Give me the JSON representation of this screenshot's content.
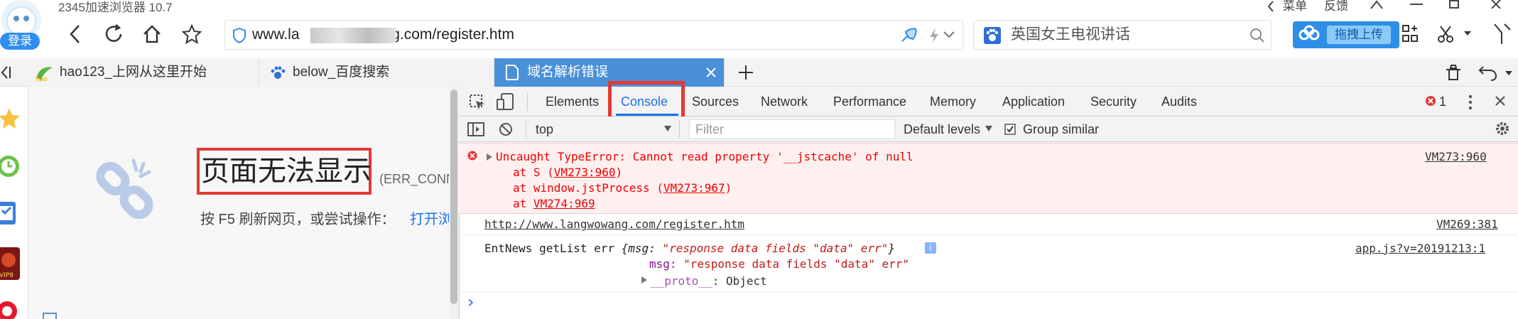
{
  "app": {
    "title": "2345加速浏览器 10.7",
    "login_label": "登录",
    "menu_label": "菜单",
    "feedback_label": "反馈"
  },
  "nav": {
    "url_prefix": "www.la",
    "url_suffix": "ng.com/register.htm",
    "search_text": "英国女王电视讲话",
    "upload_label": "拖拽上传"
  },
  "tabs": [
    {
      "label": "hao123_上网从这里开始",
      "icon": "hao123-icon"
    },
    {
      "label": "below_百度搜索",
      "icon": "baidu-paw-icon"
    },
    {
      "label": "域名解析错误",
      "icon": "page-icon",
      "active": true
    }
  ],
  "page": {
    "title": "页面无法显示",
    "code": "(ERR_CONN",
    "hint": "按 F5 刷新网页，或尝试操作：",
    "link": "打开浏"
  },
  "devtools": {
    "tabs": [
      "Elements",
      "Console",
      "Sources",
      "Network",
      "Performance",
      "Memory",
      "Application",
      "Security",
      "Audits"
    ],
    "active_tab": "Console",
    "error_count": "1",
    "context": "top",
    "filter_placeholder": "Filter",
    "levels": "Default levels",
    "group_similar": "Group similar",
    "messages": {
      "error": {
        "line1": "Uncaught TypeError: Cannot read property '__jstcache' of null",
        "line2_pre": "at S (",
        "line2_link": "VM273:960",
        "line2_post": ")",
        "line3_pre": "at window.jstProcess (",
        "line3_link": "VM273:967",
        "line3_post": ")",
        "line4_pre": "at ",
        "line4_link": "VM274:969",
        "source": "VM273:960"
      },
      "log1": {
        "text": "http://www.langwowang.com/register.htm",
        "source": "VM269:381"
      },
      "log2": {
        "prefix": "EntNews getList err ",
        "obj_open": "{msg: ",
        "obj_str": "\"response data fields \"data\" err\"",
        "obj_close": "}",
        "info_badge": "i",
        "msg_key": "msg:",
        "msg_val": "\"response data fields \"data\" err\"",
        "proto_key": "__proto__",
        "proto_val": ": Object",
        "source": "app.js?v=20191213:1"
      },
      "prompt": "›"
    }
  },
  "colors": {
    "accent": "#1a73e8",
    "active_tab": "#4a90d9",
    "highlight_box": "#e53935",
    "error_bg": "#fff0f0",
    "error_text": "#e00000"
  }
}
